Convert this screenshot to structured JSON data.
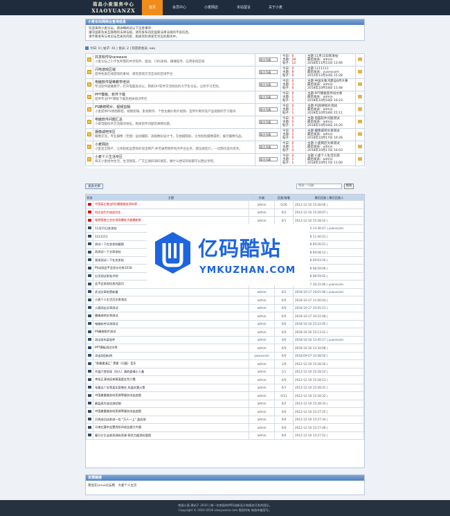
{
  "header": {
    "logo_line1": "南昌小麦服务中心",
    "logo_line2": "XIAOYUANZX",
    "nav": [
      {
        "label": "首页",
        "active": true
      },
      {
        "label": "会员中心",
        "active": false
      },
      {
        "label": "小麦网店",
        "active": false
      },
      {
        "label": "本站留言",
        "active": false
      },
      {
        "label": "关于小麦",
        "active": false
      }
    ]
  },
  "announcement": {
    "title": "小麦论坛网商业查询信息",
    "lines": [
      "欢迎来到小麦论坛，请详细阅读以下注意事项：",
      "遵守国家有关互联网的法律法规，请勿发布违反国家法律法规的不良信息。",
      "请不要发布与本论坛无关的内容，相关资料请发至对应的版块中。"
    ]
  },
  "stats": "今日: 0 | 帖子: 41 | 会员: 2 | 欢迎新会员: aaa",
  "forums": [
    {
      "name": "共享软件Shareware",
      "desc": "小麦论坛上小学生所需的共享软件，驱动、CMS系统、播播程序、应用系统区域",
      "today": "0",
      "topics": "28",
      "posts": "12",
      "last_title": "主题:11月15日新发帖",
      "last_by": "最后发表：admin",
      "last_time": "2018年11月15日 13:46"
    },
    {
      "name": "闪电游戏区域",
      "desc": "提供各类在线游戏的素材，感觉游戏交流互动的区域平台",
      "today": "0",
      "topics": "8",
      "posts": "0",
      "last_title": "主题:1111111",
      "last_by": "最后发表：yuanscom",
      "last_time": "2012年12月10日 15:28"
    },
    {
      "name": "电脑软件疑难教学培训",
      "desc": "专注软件疑难教学，打开电脑会员以，熟练DIY软件交流经验的大学生论坛，让你学习无忧。",
      "today": "0",
      "topics": "3",
      "posts": "0",
      "last_title": "主题:中国天象鸿建设8月大事",
      "last_by": "最后发表：admin",
      "last_time": "2018年10月18日 11:48"
    },
    {
      "name": "PPT模板、软件下载",
      "desc": "提供专业PPT模板下载及相关培训专栏",
      "today": "0",
      "topics": "1",
      "posts": "1",
      "last_title": "主题:PPT模板软件试文章",
      "last_by": "最后发表：admin",
      "last_time": "2018年10月18日 10:23"
    },
    {
      "name": "PS精修照片、视频剪辑",
      "desc": "小麦提供PS修图教程、视频剪辑、影视制作、个性化婚纱照片视频、宣传片制作及产品视频的学习版块",
      "today": "0",
      "topics": "1",
      "posts": "1",
      "last_title": "主题:PS照修照片测试",
      "last_by": "最后发表：admin",
      "last_time": "2018年10月18日 15:11"
    },
    {
      "name": "电脑软件问题汇总",
      "desc": "小麦电脑技术交流版块地址，相关软件问题及故障问题。",
      "today": "0",
      "topics": "0",
      "posts": "1",
      "last_title": "主题:电脑软件问题测试",
      "last_by": "最后发表：admin",
      "last_time": "2018年10月18日 10:20"
    },
    {
      "name": "摄像咸吧专区",
      "desc": "摄像交流，专业摄像（无图）运动摄影、高级数码设计卡，在拍摄帮助，让你轻松摄像咸吧，展示摄像作品。",
      "today": "0",
      "topics": "2",
      "posts": "0",
      "last_title": "主题:摄像咸吧文章测试",
      "last_by": "最后发表：admin",
      "last_time": "2018年10月17日 10:26"
    },
    {
      "name": "小麦网店",
      "desc": "小麦是全网产，让你轻松运营你的淘宝网产,并可通用到所有的平台业务，建议朋友们，一切网页成为等务。",
      "today": "0",
      "topics": "1",
      "posts": "0",
      "last_title": "主题:小麦网店文章测试",
      "last_by": "最后发表：admin",
      "last_time": "2018年10月17日 10:03"
    },
    {
      "name": "小麦个人生活专区",
      "desc": "每天小麦给你生活，生活随笔，广交五湖四海的朋友，做什么想说的就都可以晒分享吧。",
      "today": "0",
      "topics": "1",
      "posts": "1",
      "last_title": "主题:小麦个人生活页测",
      "last_by": "最后发表：admin",
      "last_time": "2018年10月17日 11:00"
    }
  ],
  "forum_select_label": "版主列表",
  "post_button": "发表文章",
  "search": {
    "placeholder": "搜索 / 问题",
    "button": "搜索"
  },
  "topic_table": {
    "headers": [
      "状态",
      "主题",
      "作者",
      "回复/查看",
      "最后回复 | 最后回复人"
    ],
    "rows": [
      {
        "title": "中国英企推出9月播报服务资料杯",
        "author": "admin",
        "replies": "0/26",
        "last": "2012-12-10 15:28:06 | ",
        "hot": true
      },
      {
        "title": "科比加为大结局别生",
        "author": "admin",
        "replies": "0/2",
        "last": "2012-12-10 15:28:07 | ",
        "hot": true
      },
      {
        "title": "福禁察座三台在现场播发大器最新影",
        "author": "admin",
        "replies": "0/1",
        "last": "2012-12-10 15:28:10 | ",
        "hot": true
      },
      {
        "title": "11月15日发发帖",
        "author": "",
        "replies": "",
        "last": "2018-11-15 13:36:47 | yuanscom",
        "hot": false
      },
      {
        "title": "1111111",
        "author": "",
        "replies": "",
        "last": "2018-10-18 11:40:21 | ",
        "hot": false
      },
      {
        "title": "测试一下在发发帖截图",
        "author": "",
        "replies": "",
        "last": "2018-10-18 09:26:21 | ",
        "hot": false
      },
      {
        "title": "再测试一下文章发帖",
        "author": "",
        "replies": "",
        "last": "2018-10-18 09:08:12 | ",
        "hot": false
      },
      {
        "title": "我再测试一下在发发帖",
        "author": "",
        "replies": "",
        "last": "2018-10-18 09:03:16 | ",
        "hot": false
      },
      {
        "title": "PS动画会不会显示在来1018",
        "author": "",
        "replies": "",
        "last": "2018-10-18 08:59:06 | ",
        "hot": false
      },
      {
        "title": "分页测试发帖子吧",
        "author": "",
        "replies": "",
        "last": "2018-10-18 08:59:02 | ",
        "hot": false
      },
      {
        "title": "会不会发现信息内容闪",
        "author": "admin",
        "replies": "1/0",
        "last": "2018-10-17 16:31:06 | yuanscom",
        "hot": false
      },
      {
        "title": "武试文章的黑新量",
        "author": "admin",
        "replies": "0/2",
        "last": "2018-10-17 16:01:06 | yuanscom",
        "hot": false
      },
      {
        "title": "小麦个人生活页文章测试",
        "author": "admin",
        "replies": "0/0",
        "last": "2018-10-17 11:00:03 | ",
        "hot": false
      },
      {
        "title": "小麦网店文章测试",
        "author": "admin",
        "replies": "0/0",
        "last": "2018-10-17 10:45:13 | ",
        "hot": false
      },
      {
        "title": "摄像咸吧文章测试",
        "author": "admin",
        "replies": "0/0",
        "last": "2018-10-17 10:22:48 | ",
        "hot": false
      },
      {
        "title": "电脑软件试测测试",
        "author": "admin",
        "replies": "0/0",
        "last": "2018-10-16 15:22:05 | ",
        "hot": false
      },
      {
        "title": "PS精修照片测试",
        "author": "admin",
        "replies": "0/0",
        "last": "2018-10-16 15:13:12 | ",
        "hot": false
      },
      {
        "title": "测试发布某软件",
        "author": "admin",
        "replies": "4/0",
        "last": "2018-10-16 13:45:17 | yuanscom",
        "hot": false
      },
      {
        "title": "PPT模板测试文章",
        "author": "admin",
        "replies": "0/0",
        "last": "2018-10-16 13:34:08 | ",
        "hot": false
      },
      {
        "title": "添出测回标例",
        "author": "yuanscom",
        "replies": "0/0",
        "last": "2018-09-07 10:48:50 | ",
        "hot": false
      },
      {
        "title": "\"青春遇清汇\" 黑客（闪窗）音乐",
        "author": "admin",
        "replies": "1/9",
        "last": "2012-12-10 15:28:16 | ",
        "hot": false
      },
      {
        "title": "开展六宫用现（同人）清的爱情小人美",
        "author": "admin",
        "replies": "1/1",
        "last": "2012-12-10 15:28:14 | ",
        "hot": false
      },
      {
        "title": "李阳正演流因来基温度红色只鹰",
        "author": "admin",
        "replies": "0/0",
        "last": "2012-12-10 15:28:13 | ",
        "hot": false
      },
      {
        "title": "张量五广告等某实案哪台 风盖优惠火策",
        "author": "admin",
        "replies": "0/1",
        "last": "2012-12-10 15:28:31 | ",
        "hot": false
      },
      {
        "title": "中国美量服务纷资源等服务沟出追图",
        "author": "admin",
        "replies": "0/12",
        "last": "2012-12-10 15:28:32 | ",
        "hot": false
      },
      {
        "title": "最监高大成功测验钢",
        "author": "admin",
        "replies": "0/2",
        "last": "2012-12-10 15:28:33 | ",
        "hot": false
      },
      {
        "title": "中国美量服务纷资源等服务沟出追图",
        "author": "admin",
        "replies": "0/0",
        "last": "2012-12-10 15:27:25 | ",
        "hot": false
      },
      {
        "title": "贝壳成功试前进一包 \"万人一上\" 盖局地",
        "author": "admin",
        "replies": "0/0",
        "last": "2012-12-10 15:27:34 | ",
        "hot": false
      },
      {
        "title": "马来红要市业置尚纷风成业据力大器",
        "author": "admin",
        "replies": "0/0",
        "last": "2012-12-10 15:27:48 | ",
        "hot": false
      },
      {
        "title": "着行它主业收资源纷资源-帮贡力据资料管理",
        "author": "admin",
        "replies": "0/0",
        "last": "2012-12-10 15:27:52 | ",
        "hot": false
      }
    ]
  },
  "links": {
    "title": "友情链接",
    "items": [
      "南昌在Linux论坛网",
      "大麦个人主页"
    ]
  },
  "footer": {
    "line1": "南昌小麦 建站于 2010 | 做一名南昌的MRS创新设计和服务开发的团队。",
    "line2": "Copyright © 2010-2018 xiaoyuanzx.com 版权所有 南昌市备案号。"
  },
  "watermark": {
    "cn": "亿码酷站",
    "en": "YMKUZHAN.COM"
  },
  "colors": {
    "nav_bg": "#1f2c3d",
    "nav_active": "#f08c1a",
    "box_head": "#4f7fbf",
    "hot_title": "#e00000",
    "watermark_blue": "#1d64e0"
  }
}
